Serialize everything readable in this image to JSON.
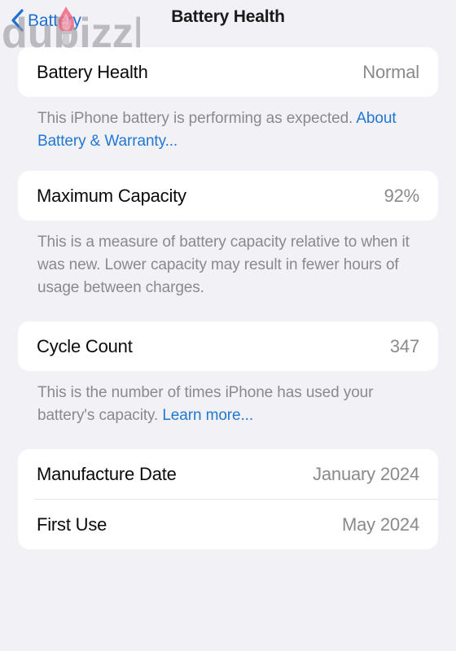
{
  "navbar": {
    "back_label": "Battery",
    "back_icon": "chevron-left-icon",
    "title": "Battery Health"
  },
  "watermark": {
    "text": "dubizzle",
    "icon": "flame-icon",
    "text_color": "#9a9aa0",
    "flame_color": "#e8667f"
  },
  "colors": {
    "background": "#f2f1f6",
    "card": "#ffffff",
    "label": "#0a0a0a",
    "value": "#8a8a8e",
    "link": "#2078d4",
    "divider": "#e6e6e9"
  },
  "sections": [
    {
      "rows": [
        {
          "label": "Battery Health",
          "value": "Normal"
        }
      ],
      "footer": {
        "text": "This iPhone battery is performing as expected. ",
        "link": "About Battery & Warranty...",
        "trailing": ""
      }
    },
    {
      "rows": [
        {
          "label": "Maximum Capacity",
          "value": "92%"
        }
      ],
      "footer": {
        "text": "This is a measure of battery capacity relative to when it was new. Lower capacity may result in fewer hours of usage between charges.",
        "link": "",
        "trailing": ""
      }
    },
    {
      "rows": [
        {
          "label": "Cycle Count",
          "value": "347"
        }
      ],
      "footer": {
        "text": "This is the number of times iPhone has used your battery's capacity. ",
        "link": "Learn more...",
        "trailing": ""
      }
    },
    {
      "rows": [
        {
          "label": "Manufacture Date",
          "value": "January 2024"
        },
        {
          "label": "First Use",
          "value": "May 2024"
        }
      ],
      "footer": null
    }
  ]
}
